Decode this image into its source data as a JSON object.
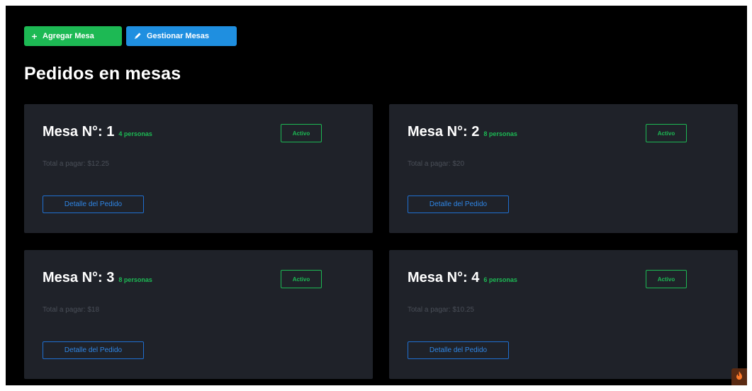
{
  "toolbar": {
    "add_label": "Agregar Mesa",
    "add_icon": "plus-icon",
    "manage_label": "Gestionar Mesas",
    "manage_icon": "pencil-icon"
  },
  "page_title": "Pedidos en mesas",
  "tables": [
    {
      "title": "Mesa N°: 1",
      "people": "4 personas",
      "status": "Activo",
      "total": "Total a pagar: $12.25",
      "detail_label": "Detalle del Pedido"
    },
    {
      "title": "Mesa N°: 2",
      "people": "8 personas",
      "status": "Activo",
      "total": "Total a pagar: $20",
      "detail_label": "Detalle del Pedido"
    },
    {
      "title": "Mesa N°: 3",
      "people": "8 personas",
      "status": "Activo",
      "total": "Total a pagar: $18",
      "detail_label": "Detalle del Pedido"
    },
    {
      "title": "Mesa N°: 4",
      "people": "6 personas",
      "status": "Activo",
      "total": "Total a pagar: $10.25",
      "detail_label": "Detalle del Pedido"
    }
  ],
  "colors": {
    "background": "#000000",
    "card": "#1f2229",
    "green": "#1db954",
    "blue": "#1f8fe0"
  },
  "corner_icon": "flame-icon"
}
